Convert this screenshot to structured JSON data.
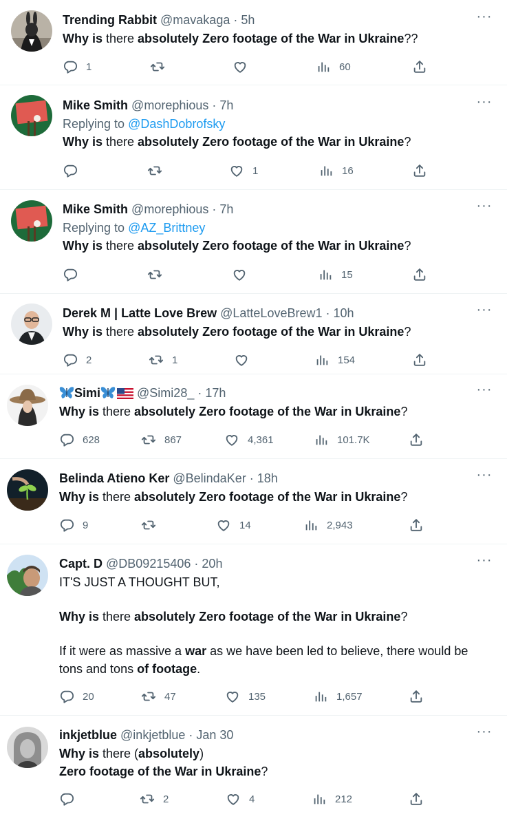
{
  "icons": {
    "reply": "reply-icon",
    "retweet": "retweet-icon",
    "like": "like-icon",
    "views": "views-icon",
    "share": "share-icon",
    "more": "more-icon"
  },
  "colors": {
    "text": "#0f1419",
    "muted": "#536471",
    "link": "#1d9bf0",
    "divider": "#eff3f4"
  },
  "tweets": [
    {
      "name": "Trending Rabbit",
      "handle": "@mavakaga",
      "sep": "·",
      "time": "5h",
      "more": "···",
      "body": [
        [
          "Why is",
          " there ",
          "absolutely Zero footage of the War in Ukraine",
          "??"
        ]
      ],
      "replies": "1",
      "retweets": "",
      "likes": "",
      "views": "60"
    },
    {
      "name": "Mike Smith",
      "handle": "@morephious",
      "sep": "·",
      "time": "7h",
      "more": "···",
      "replying_prefix": "Replying to ",
      "replying_to": "@DashDobrofsky",
      "body": [
        [
          "Why is",
          " there ",
          "absolutely Zero footage of the War in Ukraine",
          "?"
        ]
      ],
      "replies": "",
      "retweets": "",
      "likes": "1",
      "views": "16"
    },
    {
      "name": "Mike Smith",
      "handle": "@morephious",
      "sep": "·",
      "time": "7h",
      "more": "···",
      "replying_prefix": "Replying to ",
      "replying_to": "@AZ_Brittney",
      "body": [
        [
          "Why is",
          " there ",
          "absolutely Zero footage of the War in Ukraine",
          "?"
        ]
      ],
      "replies": "",
      "retweets": "",
      "likes": "",
      "views": "15"
    },
    {
      "name": "Derek M | Latte Love Brew",
      "handle": "@LatteLoveBrew1",
      "sep": "·",
      "time": "10h",
      "more": "···",
      "body": [
        [
          "Why is",
          " there ",
          "absolutely Zero footage of the War in Ukraine",
          "?"
        ]
      ],
      "replies": "2",
      "retweets": "1",
      "likes": "",
      "views": "154"
    },
    {
      "name": "Simi",
      "handle": "@Simi28_",
      "sep": "·",
      "time": "17h",
      "more": "···",
      "body": [
        [
          "Why is",
          " there ",
          "absolutely Zero footage of the War in Ukraine",
          "?"
        ]
      ],
      "replies": "628",
      "retweets": "867",
      "likes": "4,361",
      "views": "101.7K"
    },
    {
      "name": "Belinda Atieno Ker",
      "handle": "@BelindaKer",
      "sep": "·",
      "time": "18h",
      "more": "···",
      "body": [
        [
          "Why is",
          " there ",
          "absolutely Zero footage of the War in Ukraine",
          "?"
        ]
      ],
      "replies": "9",
      "retweets": "",
      "likes": "14",
      "views": "2,943"
    },
    {
      "name": "Capt. D",
      "handle": "@DB09215406",
      "sep": "·",
      "time": "20h",
      "more": "···",
      "intro": "IT'S JUST A THOUGHT BUT,",
      "body": [
        [
          "Why is",
          " there ",
          "absolutely Zero footage of the War in Ukraine",
          "?"
        ]
      ],
      "extra": {
        "a": "If it were as massive a ",
        "b": "war",
        "c": " as we have been led to believe, there would be tons and tons ",
        "d": "of footage",
        "e": "."
      },
      "replies": "20",
      "retweets": "47",
      "likes": "135",
      "views": "1,657"
    },
    {
      "name": "inkjetblue",
      "handle": "@inkjetblue",
      "sep": "·",
      "time": "Jan 30",
      "more": "···",
      "line1": {
        "a": "Why is",
        "b": " there (",
        "c": "absolutely",
        "d": ")"
      },
      "line2": {
        "a": "Zero footage of the War in Ukraine",
        "b": "?"
      },
      "replies": "",
      "retweets": "2",
      "likes": "4",
      "views": "212"
    }
  ]
}
